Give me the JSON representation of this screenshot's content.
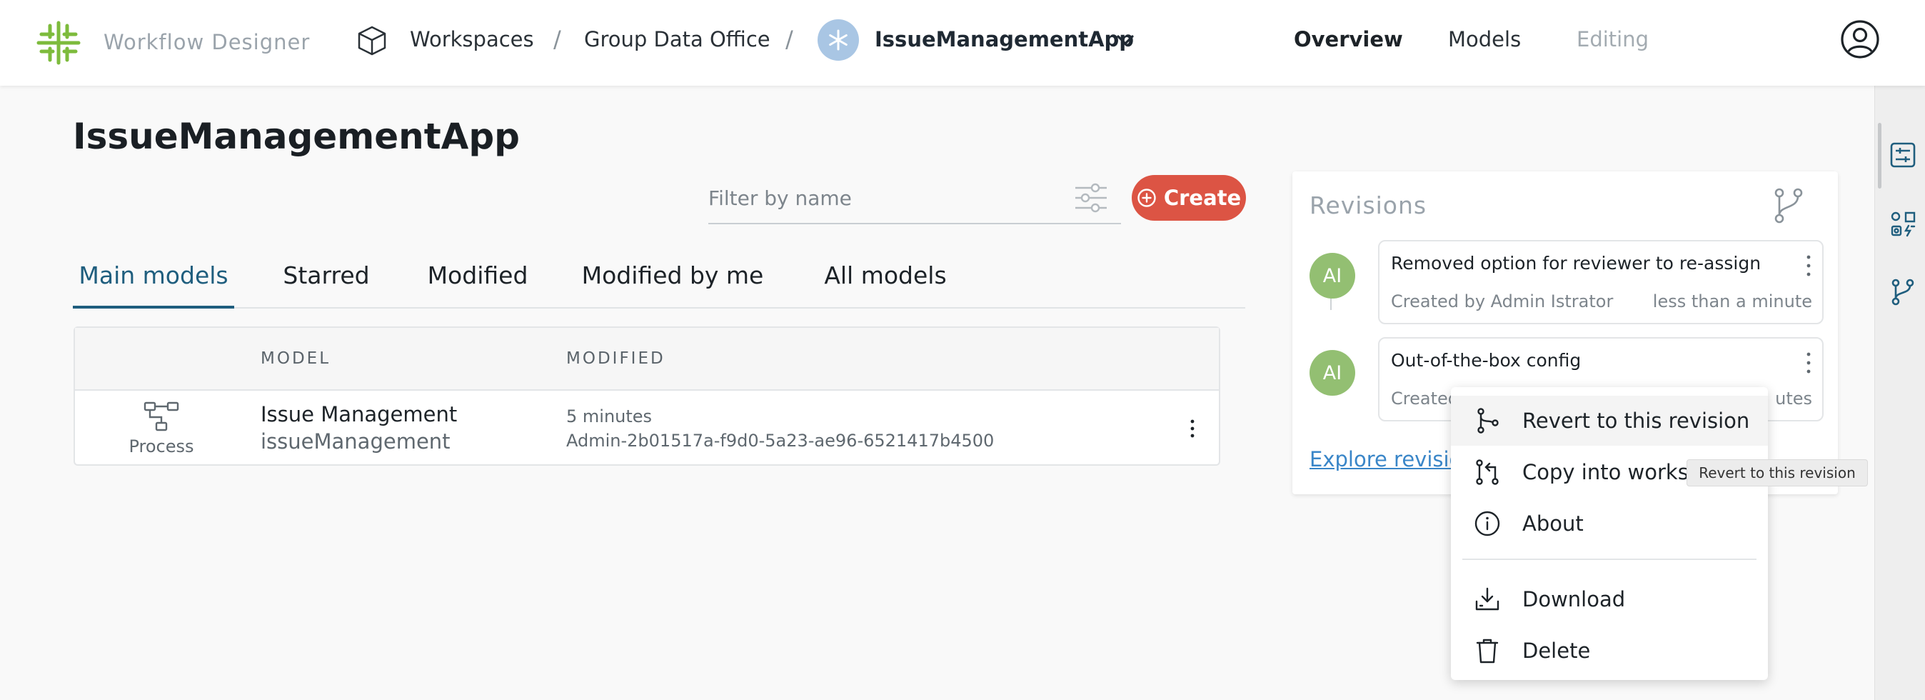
{
  "header": {
    "app_name": "Workflow Designer",
    "breadcrumbs": [
      "Workspaces",
      "Group Data Office"
    ],
    "separator": "/",
    "current_app": "IssueManagementApp",
    "nav": [
      {
        "label": "Overview",
        "state": "active"
      },
      {
        "label": "Models",
        "state": "normal"
      },
      {
        "label": "Editing",
        "state": "disabled"
      }
    ],
    "icons": {
      "logo": "workflow-logo-icon",
      "workspace": "cube-icon",
      "app": "asterisk-icon",
      "user": "user-circle-icon"
    }
  },
  "page": {
    "title": "IssueManagementApp",
    "filter_placeholder": "Filter by name",
    "create_label": "Create"
  },
  "tabs": [
    {
      "label": "Main models",
      "active": true
    },
    {
      "label": "Starred",
      "active": false
    },
    {
      "label": "Modified",
      "active": false
    },
    {
      "label": "Modified by me",
      "active": false
    },
    {
      "label": "All models",
      "active": false
    }
  ],
  "table": {
    "columns": [
      "MODEL",
      "MODIFIED"
    ],
    "rows": [
      {
        "type": "Process",
        "name": "Issue Management",
        "key": "issueManagement",
        "modified": "5 minutes",
        "modified_by": "Admin-2b01517a-f9d0-5a23-ae96-6521417b4500"
      }
    ]
  },
  "revisions": {
    "title": "Revisions",
    "items": [
      {
        "initials": "AI",
        "title": "Removed option for reviewer to re-assign",
        "created_by": "Created by Admin Istrator",
        "time": "less than a minute"
      },
      {
        "initials": "AI",
        "title": "Out-of-the-box config",
        "created_by": "Created",
        "time": "utes"
      }
    ],
    "explore_label": "Explore revisio"
  },
  "context_menu": {
    "items": [
      {
        "label": "Revert to this revision",
        "icon": "revert-branch-icon"
      },
      {
        "label": "Copy into worksp",
        "icon": "copy-branch-icon"
      },
      {
        "label": "About",
        "icon": "info-icon"
      },
      {
        "label": "Download",
        "icon": "download-icon"
      },
      {
        "label": "Delete",
        "icon": "trash-icon"
      }
    ]
  },
  "tooltip": "Revert to this revision",
  "colors": {
    "accent": "#1f5e7e",
    "create": "#dc5444",
    "logo": "#7dbb3c",
    "avatar": "#93bf72",
    "link": "#3a86c8"
  }
}
